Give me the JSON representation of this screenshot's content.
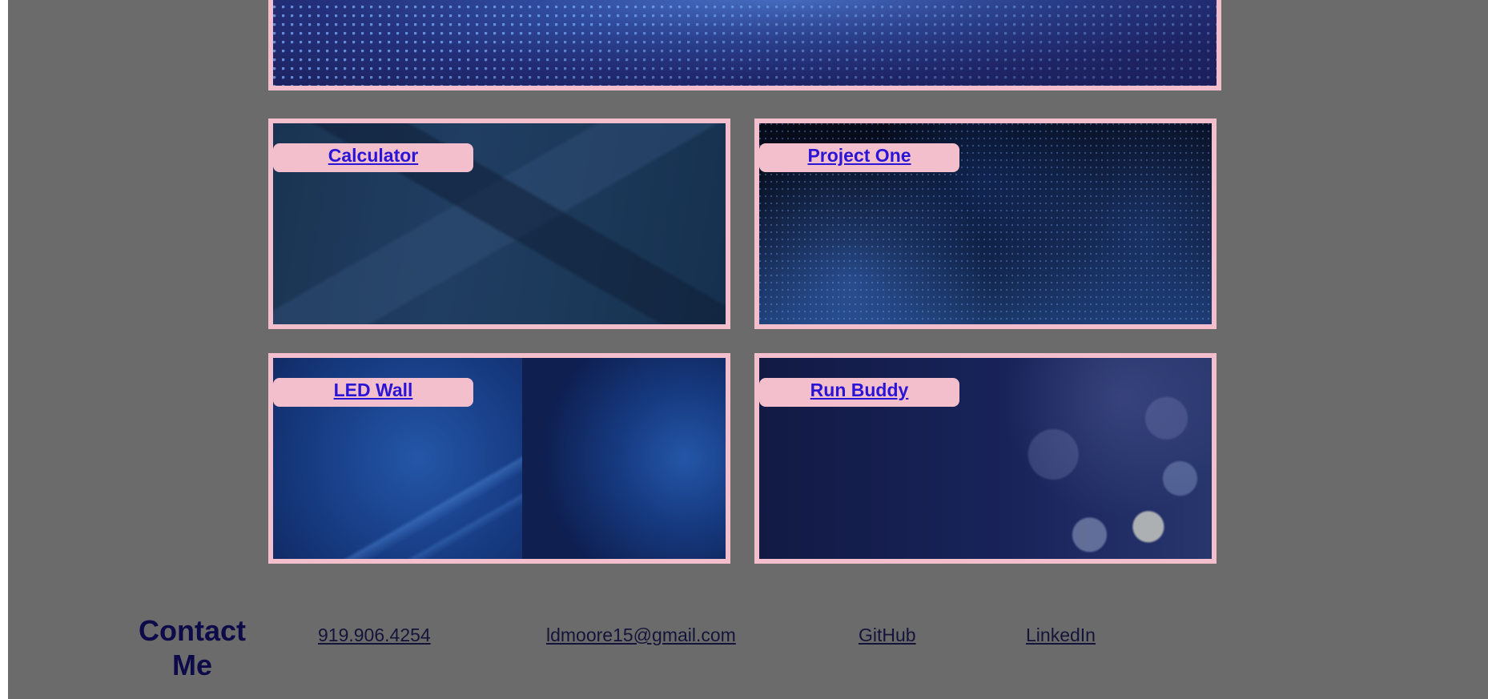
{
  "projects": [
    {
      "label": "Calculator"
    },
    {
      "label": "Project One"
    },
    {
      "label": "LED Wall"
    },
    {
      "label": "Run Buddy"
    }
  ],
  "contact": {
    "title": "Contact Me",
    "phone": "919.906.4254",
    "email": "ldmoore15@gmail.com",
    "github": "GitHub",
    "linkedin": "LinkedIn"
  },
  "colors": {
    "page_background": "#6b6b6b",
    "card_border": "#f4bfcc",
    "link_text": "#2a14d6",
    "heading_text": "#0d0a4a"
  }
}
